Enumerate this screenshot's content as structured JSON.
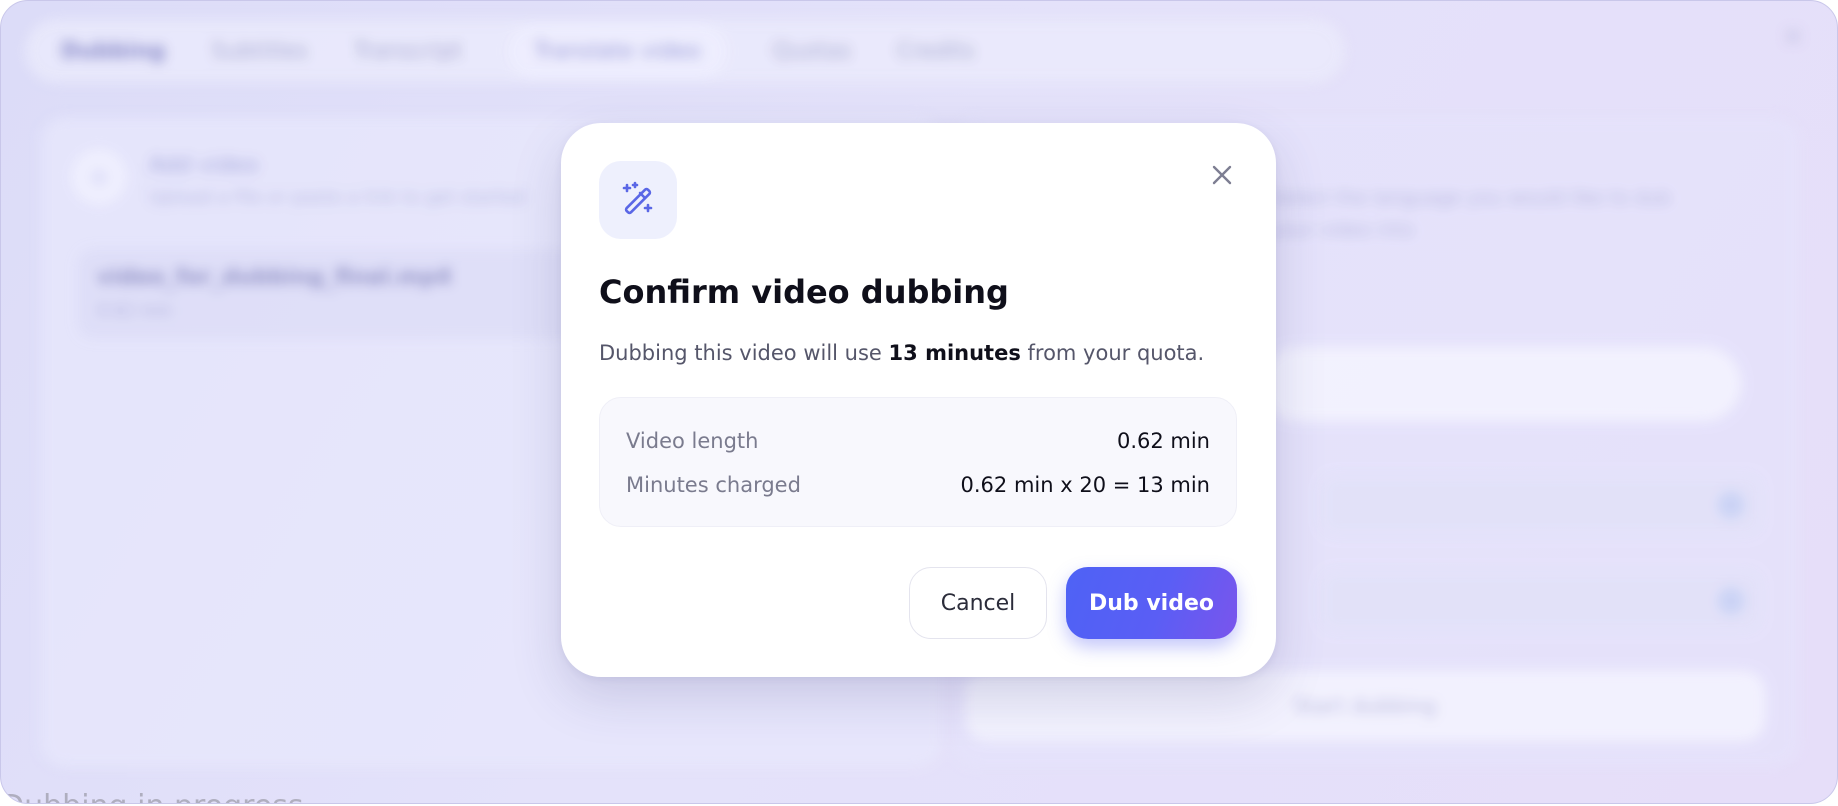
{
  "background": {
    "nav_tabs": [
      "Dubbing",
      "Subtitles",
      "Transcript",
      "Translate video",
      "Quotas",
      "Credits"
    ],
    "panel_title": "Add video",
    "panel_subtitle": "Upload a file or paste a link to get started",
    "file_name": "video_for_dubbing_final.mp4",
    "file_meta": "0.62 min",
    "right_text_1": "Select the language you would like to dub",
    "right_text_2": "your video into",
    "right_button": "Start dubbing",
    "bottom_text": "Dubbing in progress"
  },
  "modal": {
    "icon": "magic-wand-icon",
    "title": "Confirm video dubbing",
    "description_prefix": "Dubbing this video will use ",
    "description_highlight": "13 minutes",
    "description_suffix": " from your quota.",
    "details": [
      {
        "label": "Video length",
        "value": "0.62 min"
      },
      {
        "label": "Minutes charged",
        "value": "0.62 min x 20 = 13 min"
      }
    ],
    "cancel_label": "Cancel",
    "confirm_label": "Dub video"
  },
  "colors": {
    "primary": "#5660f4",
    "primary_end": "#7a55ec",
    "icon_color": "#5a67e6",
    "icon_bg": "#eef0fd"
  }
}
